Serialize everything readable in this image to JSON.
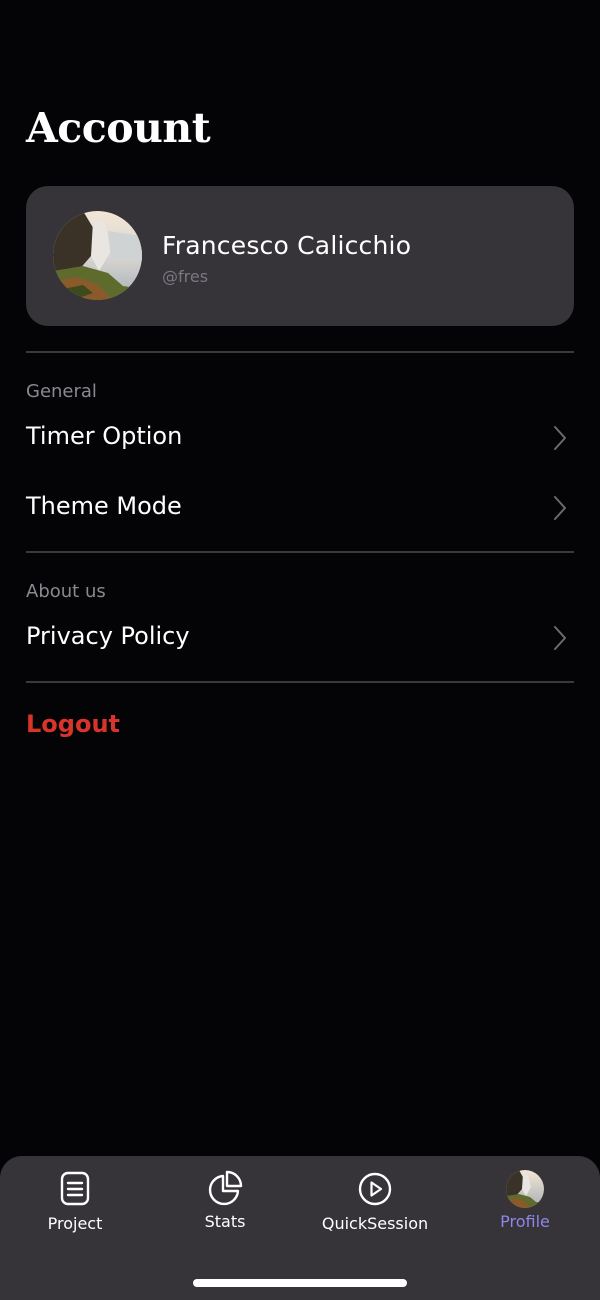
{
  "header": {
    "title": "Account"
  },
  "profile": {
    "name": "Francesco Calicchio",
    "handle": "@fres",
    "avatar_icon": "waterfall-photo"
  },
  "sections": [
    {
      "label": "General",
      "items": [
        {
          "label": "Timer Option",
          "icon": "chevron-right-icon"
        },
        {
          "label": "Theme Mode",
          "icon": "chevron-right-icon"
        }
      ]
    },
    {
      "label": "About us",
      "items": [
        {
          "label": "Privacy Policy",
          "icon": "chevron-right-icon"
        }
      ]
    }
  ],
  "logout": {
    "label": "Logout",
    "color": "#d9342b"
  },
  "tabbar": {
    "tabs": [
      {
        "label": "Project",
        "icon": "document-list-icon",
        "active": false
      },
      {
        "label": "Stats",
        "icon": "pie-chart-icon",
        "active": false
      },
      {
        "label": "QuickSession",
        "icon": "play-circle-icon",
        "active": false
      },
      {
        "label": "Profile",
        "icon": "avatar-photo",
        "active": true
      }
    ],
    "active_color": "#8e86e8",
    "inactive_color": "#ffffff"
  },
  "colors": {
    "background": "#040305",
    "card": "#363438",
    "divider": "#3a383d",
    "muted_text": "#8b8990"
  }
}
